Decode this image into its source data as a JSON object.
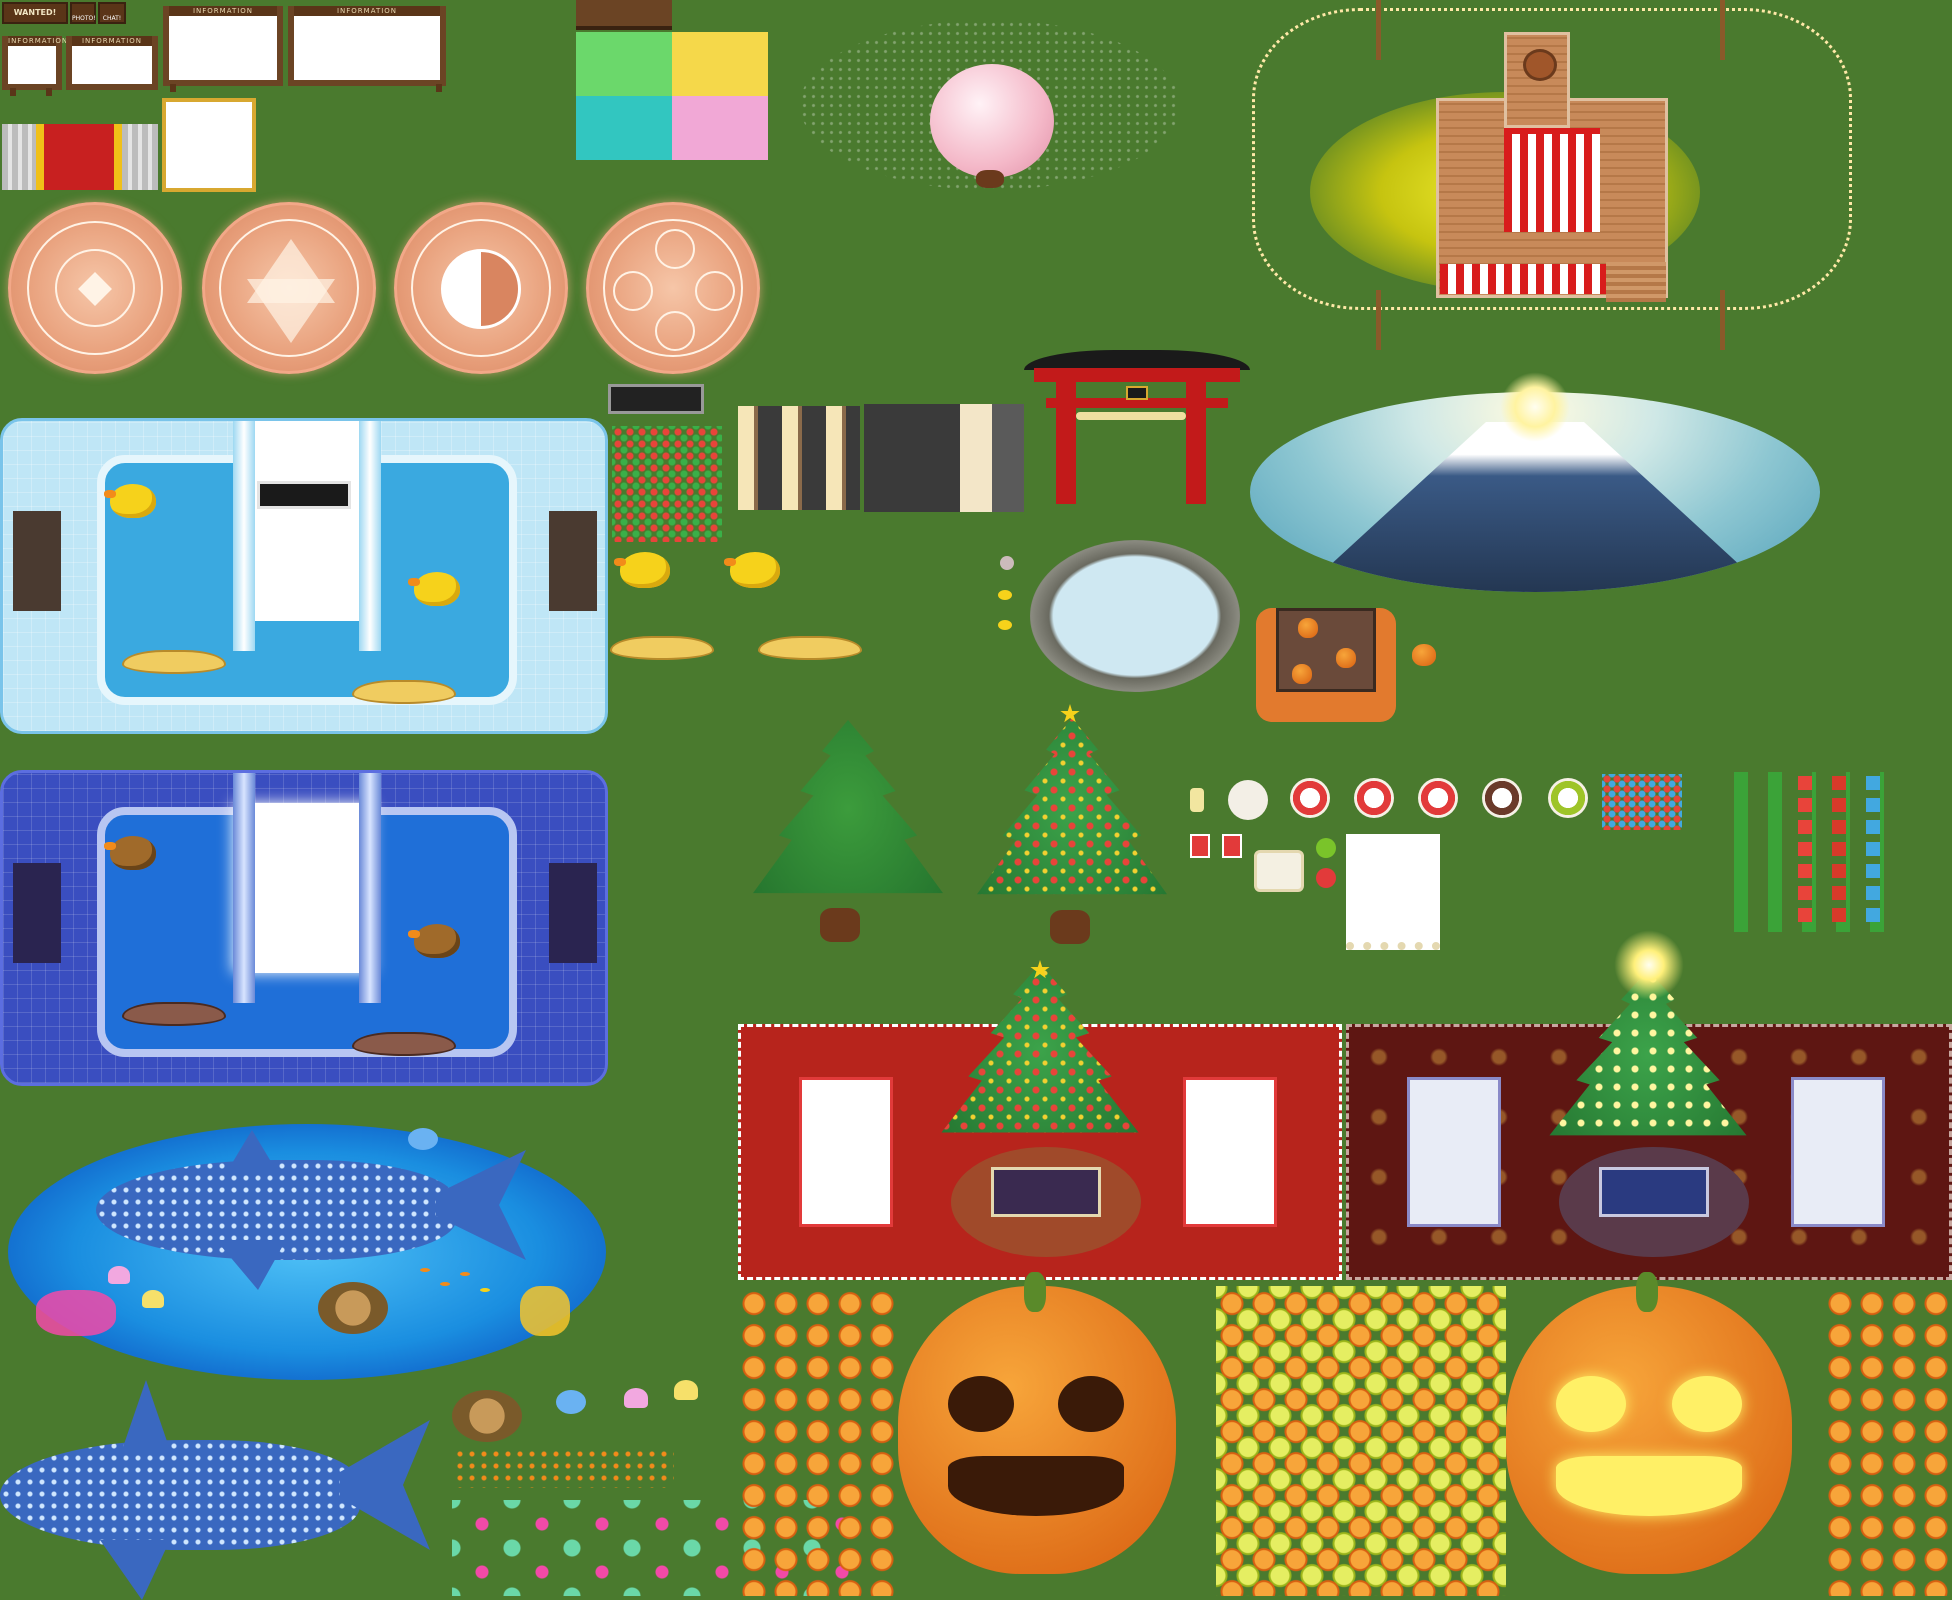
{
  "sheet": {
    "title": "",
    "boards": {
      "wanted_label": "WANTED!",
      "photo_label": "PHOTO!",
      "chat_label": "CHAT!",
      "information_label": "INFORMATION"
    }
  },
  "colors": {
    "grass": "#4a7a2e",
    "water": "#3aa9e0",
    "night_water": "#2a5ac8",
    "carpet_red": "#b7241c",
    "carpet_dark": "#5e1612",
    "pumpkin": "#e07a1e",
    "pine": "#2f7d34"
  },
  "icons": [
    "magic-circle-icon",
    "hexagram-circle-icon",
    "yin-yang-circle-icon",
    "rose-circle-icon",
    "cherry-blossom-tree-icon",
    "torii-gate-icon",
    "mount-fuji-icon",
    "hot-spring-icon",
    "rubber-duck-icon",
    "banana-boat-icon",
    "christmas-tree-icon",
    "pine-tree-icon",
    "jack-o-lantern-icon",
    "whale-shark-icon",
    "sea-turtle-icon",
    "jellyfish-icon",
    "gift-box-icon",
    "cake-icon"
  ]
}
